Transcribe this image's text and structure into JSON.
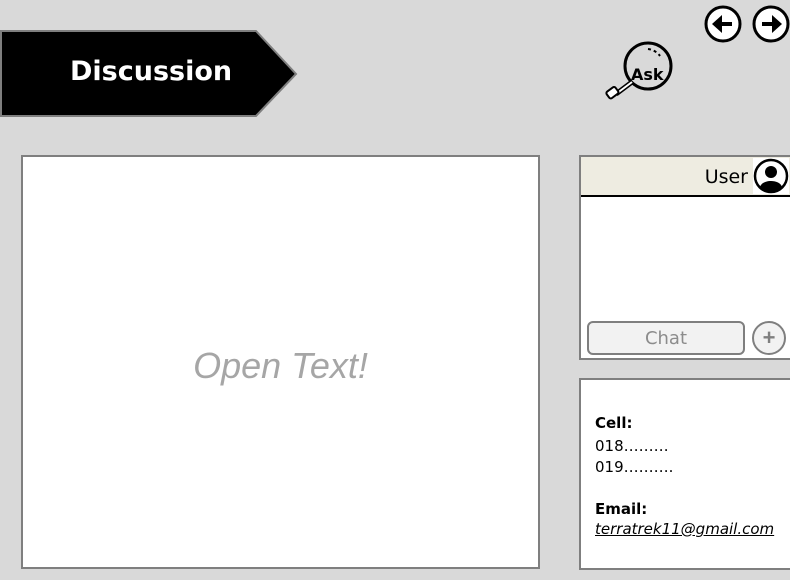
{
  "header": {
    "title": "Discussion",
    "ask_label": "Ask",
    "back_icon": "arrow-left-icon",
    "forward_icon": "arrow-right-icon"
  },
  "main": {
    "placeholder": "Open Text!"
  },
  "chat": {
    "user_label": "User",
    "avatar_icon": "user-avatar-icon",
    "chat_button_label": "Chat",
    "add_icon": "plus-icon"
  },
  "contact": {
    "cell_label": "Cell:",
    "cell_numbers": [
      "018………",
      "019………."
    ],
    "email_label": "Email:",
    "email": "terratrek11@gmail.com"
  },
  "colors": {
    "background": "#d9d9d9",
    "banner": "#000000",
    "panel_border": "#7f7f7f",
    "user_header": "#eeece1",
    "placeholder_text": "#a6a6a6"
  }
}
